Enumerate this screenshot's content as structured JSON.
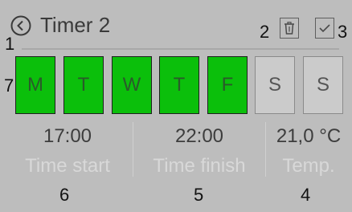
{
  "header": {
    "title": "Timer 2",
    "back_icon": "circle-chevron-left-icon",
    "delete_icon": "trash-icon",
    "confirm_icon": "check-icon"
  },
  "callouts": {
    "back": "1",
    "delete": "2",
    "confirm": "3",
    "temp": "4",
    "time_finish": "5",
    "time_start": "6",
    "days": "7"
  },
  "days": [
    {
      "label": "M",
      "active": true
    },
    {
      "label": "T",
      "active": true
    },
    {
      "label": "W",
      "active": true
    },
    {
      "label": "T",
      "active": true
    },
    {
      "label": "F",
      "active": true
    },
    {
      "label": "S",
      "active": false
    },
    {
      "label": "S",
      "active": false
    }
  ],
  "fields": {
    "time_start": {
      "value": "17:00",
      "label": "Time start"
    },
    "time_finish": {
      "value": "22:00",
      "label": "Time finish"
    },
    "temp": {
      "value": "21,0 °C",
      "label": "Temp."
    }
  },
  "colors": {
    "background": "#bdbdbd",
    "day_active": "#0bbf0b",
    "label_text": "#d8d8d8"
  }
}
